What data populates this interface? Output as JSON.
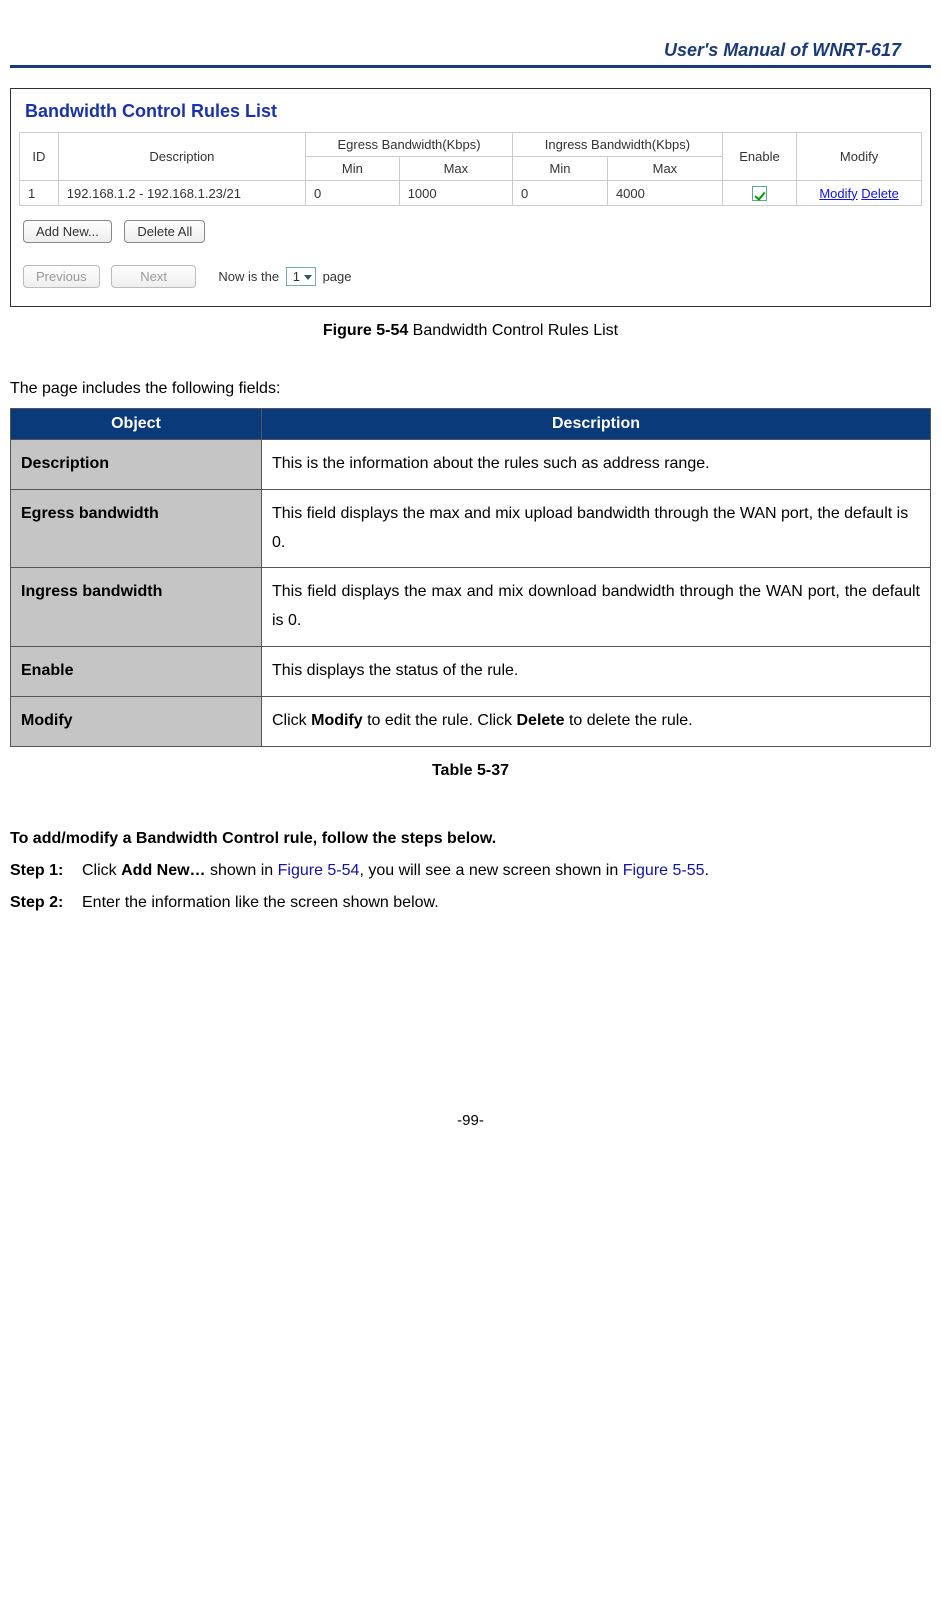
{
  "header": "User's Manual of WNRT-617",
  "screenshot": {
    "title": "Bandwidth Control Rules List",
    "cols": {
      "id": "ID",
      "desc": "Description",
      "egress_group": "Egress Bandwidth(Kbps)",
      "ingress_group": "Ingress Bandwidth(Kbps)",
      "min": "Min",
      "max": "Max",
      "enable": "Enable",
      "modify": "Modify"
    },
    "row": {
      "id": "1",
      "desc": "192.168.1.2 - 192.168.1.23/21",
      "eg_min": "0",
      "eg_max": "1000",
      "in_min": "0",
      "in_max": "4000",
      "modify": "Modify",
      "delete": "Delete"
    },
    "buttons": {
      "add": "Add New...",
      "del": "Delete All",
      "prev": "Previous",
      "next": "Next"
    },
    "pager_pre": "Now is the",
    "pager_val": "1",
    "pager_post": "page"
  },
  "figcap_bold": "Figure 5-54",
  "figcap_rest": " Bandwidth Control Rules List",
  "intro": "The page includes the following fields:",
  "desc_table": {
    "h_obj": "Object",
    "h_desc": "Description",
    "rows": [
      {
        "obj": "Description",
        "desc": "This is the information about the rules such as address range."
      },
      {
        "obj": "Egress bandwidth",
        "desc": "This field displays the max and mix upload bandwidth through the WAN port, the default is 0."
      },
      {
        "obj": "Ingress bandwidth",
        "desc": "This field displays the max and mix download bandwidth through the WAN port, the default is 0."
      },
      {
        "obj": "Enable",
        "desc": "This displays the status of the rule."
      }
    ],
    "modify_row": {
      "obj": "Modify",
      "pre": "Click ",
      "b1": "Modify",
      "mid": " to edit the rule. Click ",
      "b2": "Delete",
      "post": " to delete the rule."
    }
  },
  "table_cap": "Table 5-37",
  "steps_heading": "To add/modify a Bandwidth Control rule, follow the steps below.",
  "step1_lbl": "Step 1:",
  "step1_pre": "Click ",
  "step1_bold": "Add New…",
  "step1_mid": " shown in ",
  "step1_link1": "Figure 5-54",
  "step1_mid2": ", you will see a new screen shown in ",
  "step1_link2": "Figure 5-55",
  "step1_post": ".",
  "step2_lbl": "Step 2:",
  "step2_txt": "Enter the information like the screen shown below.",
  "footer": "-99-"
}
